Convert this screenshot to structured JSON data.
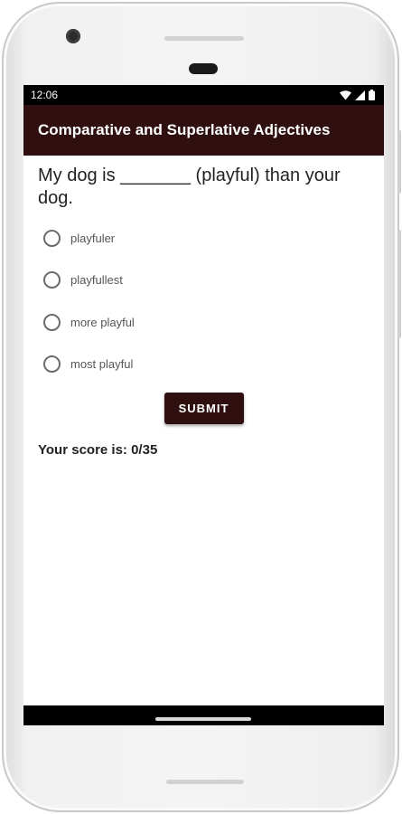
{
  "status_bar": {
    "time": "12:06",
    "icons": [
      "wifi-icon",
      "signal-icon",
      "battery-icon"
    ]
  },
  "app_bar": {
    "title": "Comparative and Superlative Adjectives",
    "color": "#2f0f0f"
  },
  "quiz": {
    "question": "My dog is _______ (playful) than your dog.",
    "options": [
      {
        "label": "playfuler",
        "selected": false
      },
      {
        "label": "playfullest",
        "selected": false
      },
      {
        "label": "more playful",
        "selected": false
      },
      {
        "label": "most playful",
        "selected": false
      }
    ],
    "submit_label": "SUBMIT",
    "score_text": "Your score is: 0/35"
  }
}
